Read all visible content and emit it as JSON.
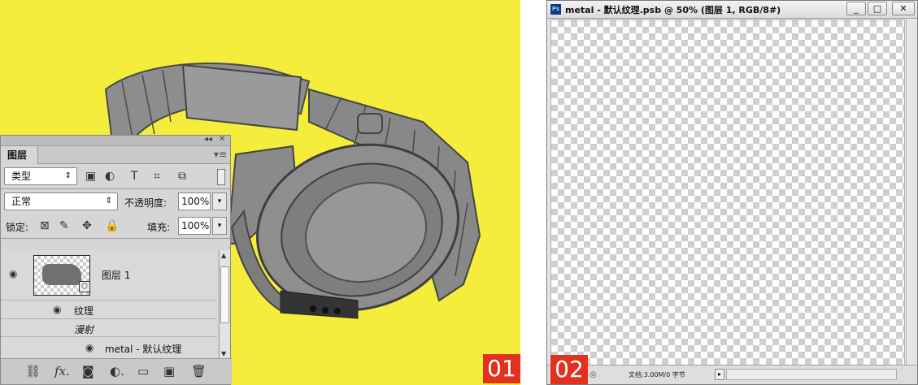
{
  "left_panel": {
    "badge": "01",
    "layers_panel": {
      "collapse_icon": "◂◂",
      "close_icon": "✕",
      "tab_label": "图层",
      "menu_icon": "▾≡",
      "filter_type": "类型",
      "blend_mode": "正常",
      "opacity_label": "不透明度:",
      "opacity_value": "100%",
      "lock_label": "锁定:",
      "fill_label": "填充:",
      "fill_value": "100%",
      "layers": [
        {
          "name": "图层 1"
        },
        {
          "name": "纹理"
        },
        {
          "name": "漫射"
        },
        {
          "name": "metal - 默认纹理"
        }
      ],
      "bottom_icons": [
        "link-icon",
        "fx-icon",
        "mask-icon",
        "adjustment-icon",
        "folder-icon",
        "new-layer-icon",
        "trash-icon"
      ]
    }
  },
  "right_window": {
    "badge": "02",
    "title": "metal - 默认纹理.psb @ 50% (图层 1, RGB/8#)",
    "app_icon": "Ps",
    "minimize": "_",
    "maximize": "□",
    "close": "✕",
    "status_text": "文档:3.00M/0 字节"
  },
  "colors": {
    "background_yellow": "#f5ed3c",
    "badge_red": "#e1321f"
  }
}
